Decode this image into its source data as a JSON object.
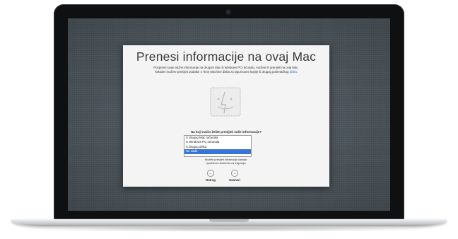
{
  "window": {
    "title": "Prenesi informacije na ovaj Mac",
    "description_line1": "Pospremi svoje važne informacije na drugom Mac ili Windows PC računalu, možete ih prenijeti na ovaj Mac.",
    "description_line2_pre": "Također možete prenijeti podatke s Time Machine diska za sigurnosne kopije ili drugog pokretačkog ",
    "description_line2_link": "diska",
    "description_line2_post": "."
  },
  "question": "Na koji način želite prenijeti vaše informacije?",
  "options": [
    "S drugog Mac računala",
    "S Windows PC računala",
    "S drugog diska",
    "Ne sada"
  ],
  "selected_option": "Ne sada",
  "note_line1": "Možete prenijeti informacije kasnije,",
  "note_line2": "upotrebom Asistenta za migraciju.",
  "buttons": {
    "back": "Natrag",
    "continue": "Nastavi"
  },
  "colors": {
    "selection": "#3875d7",
    "link": "#2f6ed0"
  }
}
